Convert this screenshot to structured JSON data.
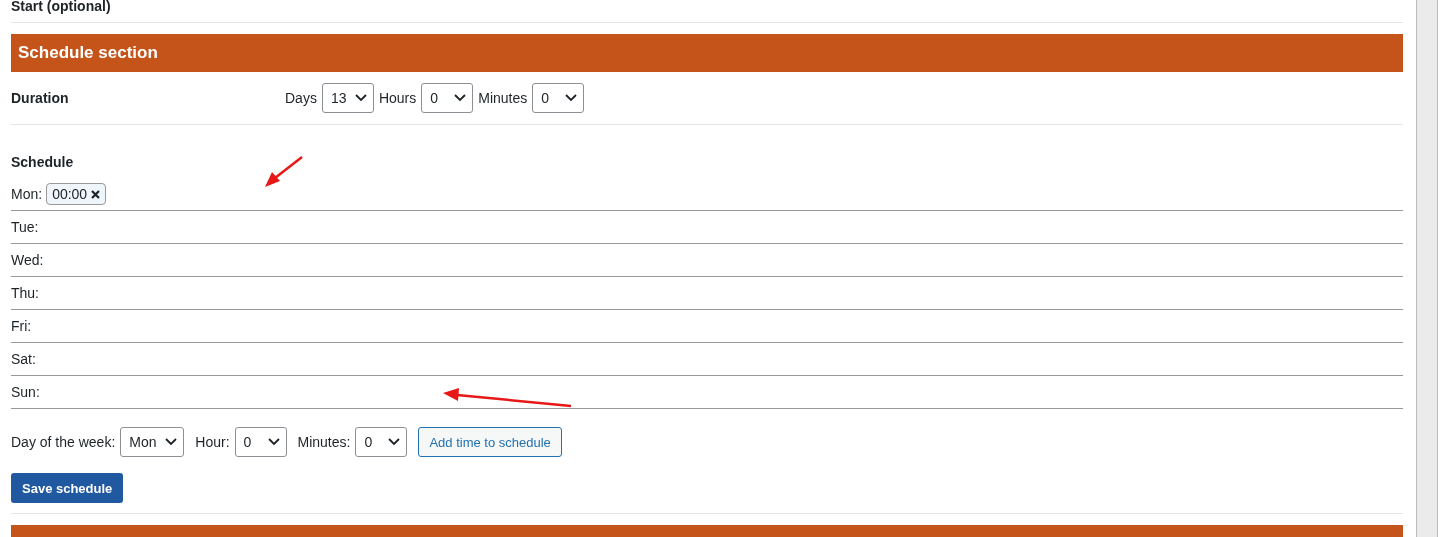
{
  "previous_field": {
    "label": "Start (optional)"
  },
  "section": {
    "title": "Schedule section"
  },
  "duration": {
    "label": "Duration",
    "fields": [
      {
        "label": "Days",
        "value": "13"
      },
      {
        "label": "Hours",
        "value": "0"
      },
      {
        "label": "Minutes",
        "value": "0"
      }
    ]
  },
  "schedule": {
    "label": "Schedule",
    "days": [
      {
        "day": "Mon:",
        "times": [
          "00:00"
        ]
      },
      {
        "day": "Tue:"
      },
      {
        "day": "Wed:"
      },
      {
        "day": "Thu:"
      },
      {
        "day": "Fri:"
      },
      {
        "day": "Sat:"
      },
      {
        "day": "Sun:"
      }
    ]
  },
  "add_form": {
    "fields": [
      {
        "label": "Day of the week:",
        "value": "Mon"
      },
      {
        "label": "Hour:",
        "value": "0"
      },
      {
        "label": "Minutes:",
        "value": "0"
      }
    ],
    "add_button": "Add time to schedule"
  },
  "save_button": "Save schedule"
}
